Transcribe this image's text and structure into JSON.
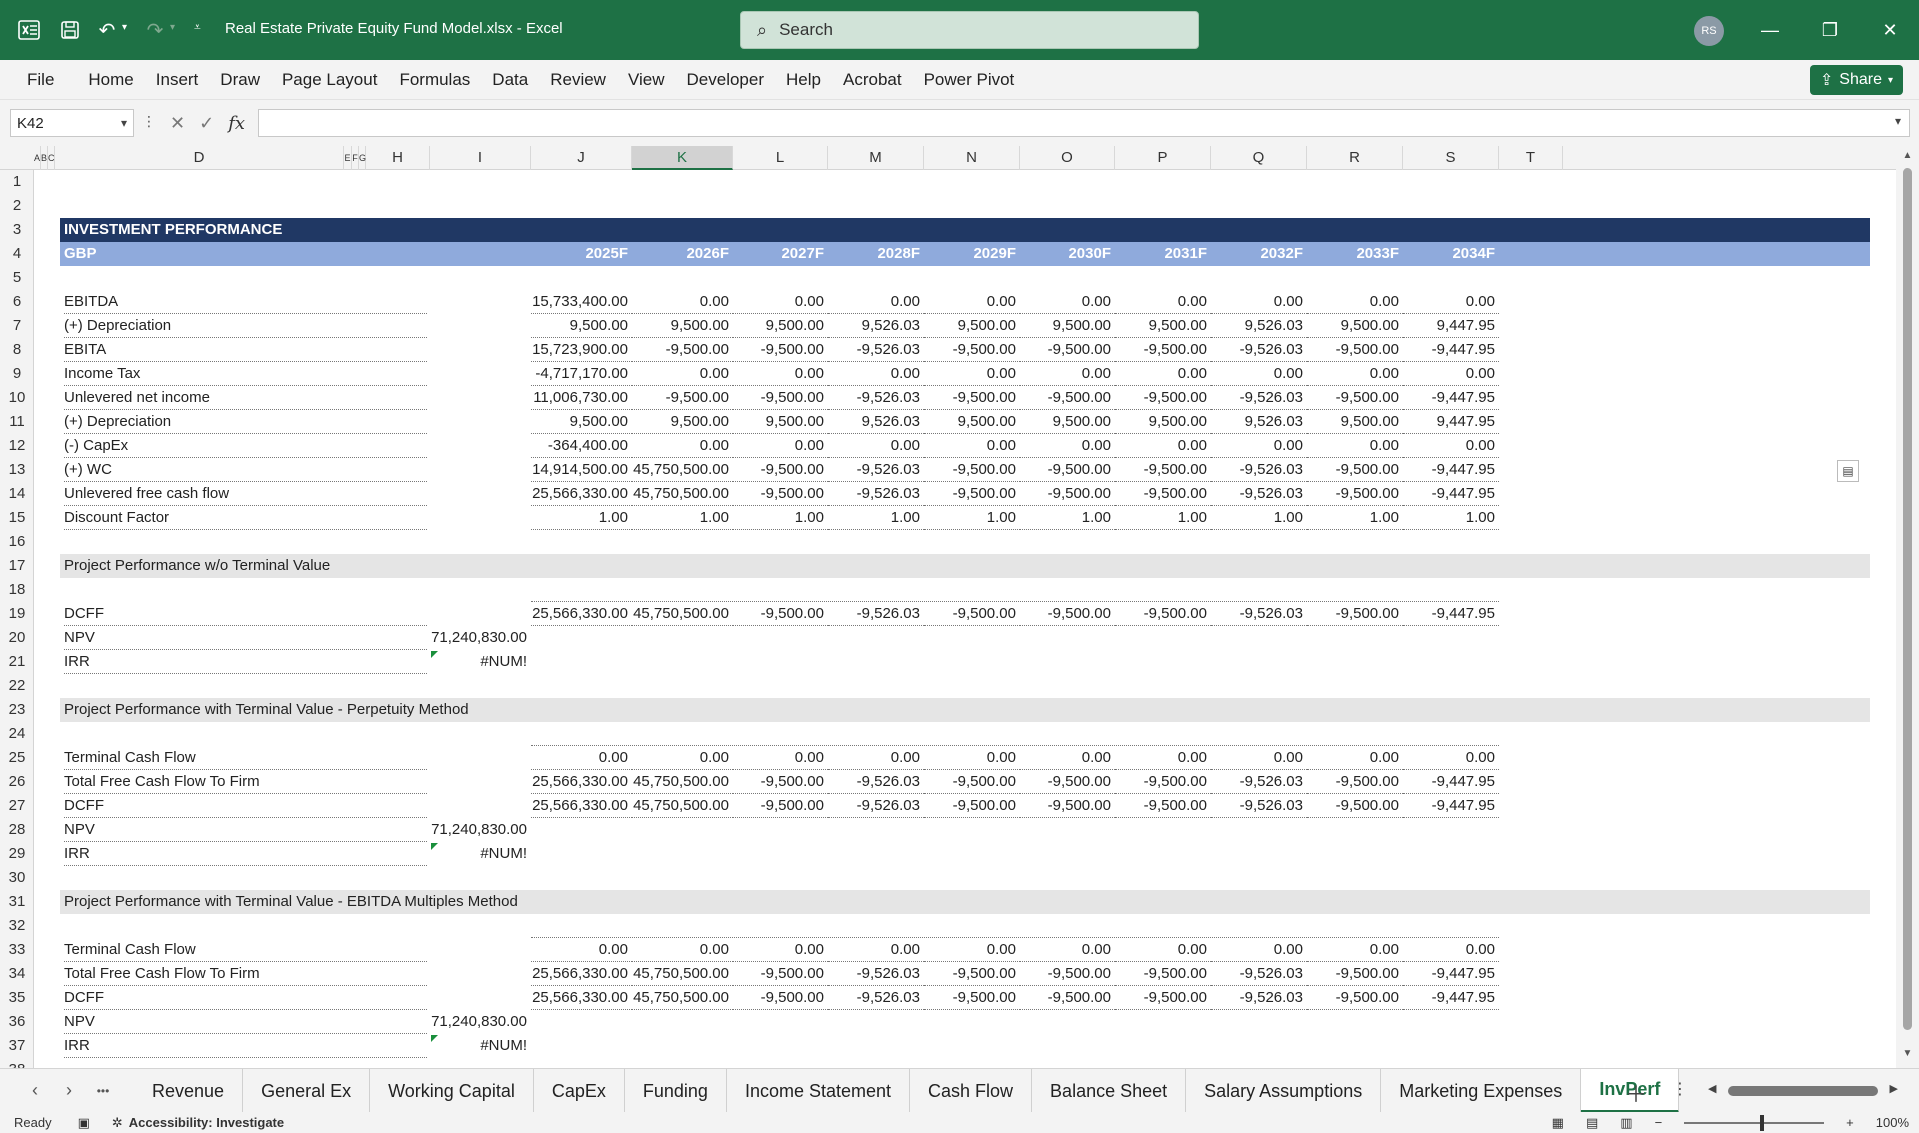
{
  "window": {
    "file_title": "Real Estate Private Equity Fund Model.xlsx  -  Excel",
    "search_placeholder": "Search",
    "avatar_initials": "RS"
  },
  "ribbon": {
    "tabs": [
      "File",
      "Home",
      "Insert",
      "Draw",
      "Page Layout",
      "Formulas",
      "Data",
      "Review",
      "View",
      "Developer",
      "Help",
      "Acrobat",
      "Power Pivot"
    ],
    "share_label": "Share"
  },
  "formula_bar": {
    "name_box": "K42",
    "fx_label": "fx",
    "formula": ""
  },
  "columns": {
    "headers": [
      "A",
      "B",
      "C",
      "D",
      "E",
      "F",
      "G",
      "H",
      "I",
      "J",
      "K",
      "L",
      "M",
      "N",
      "O",
      "P",
      "Q",
      "R",
      "S",
      "T"
    ],
    "selected": "K"
  },
  "rows": [
    "1",
    "2",
    "3",
    "4",
    "5",
    "6",
    "7",
    "8",
    "9",
    "10",
    "11",
    "12",
    "13",
    "14",
    "15",
    "16",
    "17",
    "18",
    "19",
    "20",
    "21",
    "22",
    "23",
    "24",
    "25",
    "26",
    "27",
    "28",
    "29",
    "30",
    "31",
    "32",
    "33",
    "34",
    "35",
    "36",
    "37",
    "38"
  ],
  "sheet": {
    "title": "INVESTMENT PERFORMANCE",
    "currency": "GBP",
    "years": [
      "2025F",
      "2026F",
      "2027F",
      "2028F",
      "2029F",
      "2030F",
      "2031F",
      "2032F",
      "2033F",
      "2034F"
    ],
    "section1": [
      {
        "label": "EBITDA",
        "values": [
          "15,733,400.00",
          "0.00",
          "0.00",
          "0.00",
          "0.00",
          "0.00",
          "0.00",
          "0.00",
          "0.00",
          "0.00"
        ]
      },
      {
        "label": "(+) Depreciation",
        "values": [
          "9,500.00",
          "9,500.00",
          "9,500.00",
          "9,526.03",
          "9,500.00",
          "9,500.00",
          "9,500.00",
          "9,526.03",
          "9,500.00",
          "9,447.95"
        ]
      },
      {
        "label": "EBITA",
        "values": [
          "15,723,900.00",
          "-9,500.00",
          "-9,500.00",
          "-9,526.03",
          "-9,500.00",
          "-9,500.00",
          "-9,500.00",
          "-9,526.03",
          "-9,500.00",
          "-9,447.95"
        ]
      },
      {
        "label": "Income Tax",
        "values": [
          "-4,717,170.00",
          "0.00",
          "0.00",
          "0.00",
          "0.00",
          "0.00",
          "0.00",
          "0.00",
          "0.00",
          "0.00"
        ]
      },
      {
        "label": "Unlevered net income",
        "values": [
          "11,006,730.00",
          "-9,500.00",
          "-9,500.00",
          "-9,526.03",
          "-9,500.00",
          "-9,500.00",
          "-9,500.00",
          "-9,526.03",
          "-9,500.00",
          "-9,447.95"
        ]
      },
      {
        "label": "(+) Depreciation",
        "values": [
          "9,500.00",
          "9,500.00",
          "9,500.00",
          "9,526.03",
          "9,500.00",
          "9,500.00",
          "9,500.00",
          "9,526.03",
          "9,500.00",
          "9,447.95"
        ]
      },
      {
        "label": "(-) CapEx",
        "values": [
          "-364,400.00",
          "0.00",
          "0.00",
          "0.00",
          "0.00",
          "0.00",
          "0.00",
          "0.00",
          "0.00",
          "0.00"
        ]
      },
      {
        "label": "(+) WC",
        "values": [
          "14,914,500.00",
          "45,750,500.00",
          "-9,500.00",
          "-9,526.03",
          "-9,500.00",
          "-9,500.00",
          "-9,500.00",
          "-9,526.03",
          "-9,500.00",
          "-9,447.95"
        ]
      },
      {
        "label": "Unlevered free cash flow",
        "values": [
          "25,566,330.00",
          "45,750,500.00",
          "-9,500.00",
          "-9,526.03",
          "-9,500.00",
          "-9,500.00",
          "-9,500.00",
          "-9,526.03",
          "-9,500.00",
          "-9,447.95"
        ]
      },
      {
        "label": "Discount Factor",
        "values": [
          "1.00",
          "1.00",
          "1.00",
          "1.00",
          "1.00",
          "1.00",
          "1.00",
          "1.00",
          "1.00",
          "1.00"
        ]
      }
    ],
    "section2": {
      "title": "Project Performance w/o Terminal Value",
      "dcff_label": "DCFF",
      "dcff": [
        "25,566,330.00",
        "45,750,500.00",
        "-9,500.00",
        "-9,526.03",
        "-9,500.00",
        "-9,500.00",
        "-9,500.00",
        "-9,526.03",
        "-9,500.00",
        "-9,447.95"
      ],
      "npv_label": "NPV",
      "npv": "71,240,830.00",
      "irr_label": "IRR",
      "irr": "#NUM!"
    },
    "section3": {
      "title": "Project Performance with Terminal Value - Perpetuity Method",
      "terminal_label": "Terminal Cash Flow",
      "terminal": [
        "0.00",
        "0.00",
        "0.00",
        "0.00",
        "0.00",
        "0.00",
        "0.00",
        "0.00",
        "0.00",
        "0.00"
      ],
      "total_label": "Total Free Cash Flow To Firm",
      "total": [
        "25,566,330.00",
        "45,750,500.00",
        "-9,500.00",
        "-9,526.03",
        "-9,500.00",
        "-9,500.00",
        "-9,500.00",
        "-9,526.03",
        "-9,500.00",
        "-9,447.95"
      ],
      "dcff_label": "DCFF",
      "dcff": [
        "25,566,330.00",
        "45,750,500.00",
        "-9,500.00",
        "-9,526.03",
        "-9,500.00",
        "-9,500.00",
        "-9,500.00",
        "-9,526.03",
        "-9,500.00",
        "-9,447.95"
      ],
      "npv_label": "NPV",
      "npv": "71,240,830.00",
      "irr_label": "IRR",
      "irr": "#NUM!"
    },
    "section4": {
      "title": "Project Performance with Terminal Value - EBITDA Multiples Method",
      "terminal_label": "Terminal Cash Flow",
      "terminal": [
        "0.00",
        "0.00",
        "0.00",
        "0.00",
        "0.00",
        "0.00",
        "0.00",
        "0.00",
        "0.00",
        "0.00"
      ],
      "total_label": "Total Free Cash Flow To Firm",
      "total": [
        "25,566,330.00",
        "45,750,500.00",
        "-9,500.00",
        "-9,526.03",
        "-9,500.00",
        "-9,500.00",
        "-9,500.00",
        "-9,526.03",
        "-9,500.00",
        "-9,447.95"
      ],
      "dcff_label": "DCFF",
      "dcff": [
        "25,566,330.00",
        "45,750,500.00",
        "-9,500.00",
        "-9,526.03",
        "-9,500.00",
        "-9,500.00",
        "-9,500.00",
        "-9,526.03",
        "-9,500.00",
        "-9,447.95"
      ],
      "npv_label": "NPV",
      "npv": "71,240,830.00",
      "irr_label": "IRR",
      "irr": "#NUM!"
    }
  },
  "sheet_tabs": {
    "tabs": [
      "Revenue",
      "General Ex",
      "Working Capital",
      "CapEx",
      "Funding",
      "Income Statement",
      "Cash Flow",
      "Balance Sheet",
      "Salary Assumptions",
      "Marketing Expenses",
      "InvPerf"
    ],
    "active": "InvPerf",
    "more": "•••"
  },
  "status_bar": {
    "ready": "Ready",
    "accessibility": "Accessibility: Investigate",
    "zoom": "100%"
  },
  "colors": {
    "excel_green": "#1e7145",
    "header_navy": "#203864",
    "header_lightblue": "#8faadc",
    "section_gray": "#e5e5e5"
  }
}
